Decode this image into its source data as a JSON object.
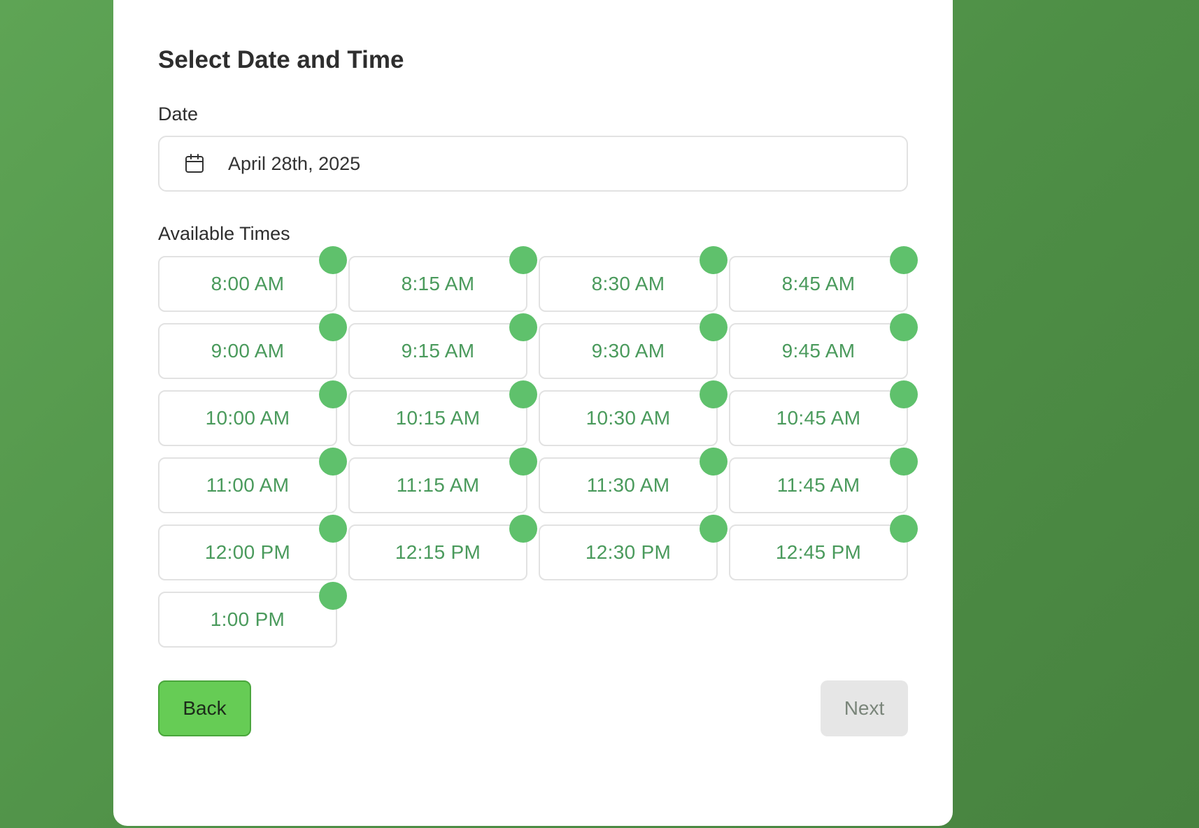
{
  "form": {
    "title": "Select Date and Time",
    "date_label": "Date",
    "date_value": "April 28th, 2025",
    "date_icon": "calendar-icon",
    "times_label": "Available Times",
    "times": [
      "8:00 AM",
      "8:15 AM",
      "8:30 AM",
      "8:45 AM",
      "9:00 AM",
      "9:15 AM",
      "9:30 AM",
      "9:45 AM",
      "10:00 AM",
      "10:15 AM",
      "10:30 AM",
      "10:45 AM",
      "11:00 AM",
      "11:15 AM",
      "11:30 AM",
      "11:45 AM",
      "12:00 PM",
      "12:15 PM",
      "12:30 PM",
      "12:45 PM",
      "1:00 PM"
    ]
  },
  "buttons": {
    "back_label": "Back",
    "next_label": "Next"
  },
  "colors": {
    "background": "#53974a",
    "slot_text": "#4a9a5c",
    "availability_dot": "#5fc16c",
    "back_button": "#66cc55",
    "next_button_disabled": "#e6e6e6"
  }
}
